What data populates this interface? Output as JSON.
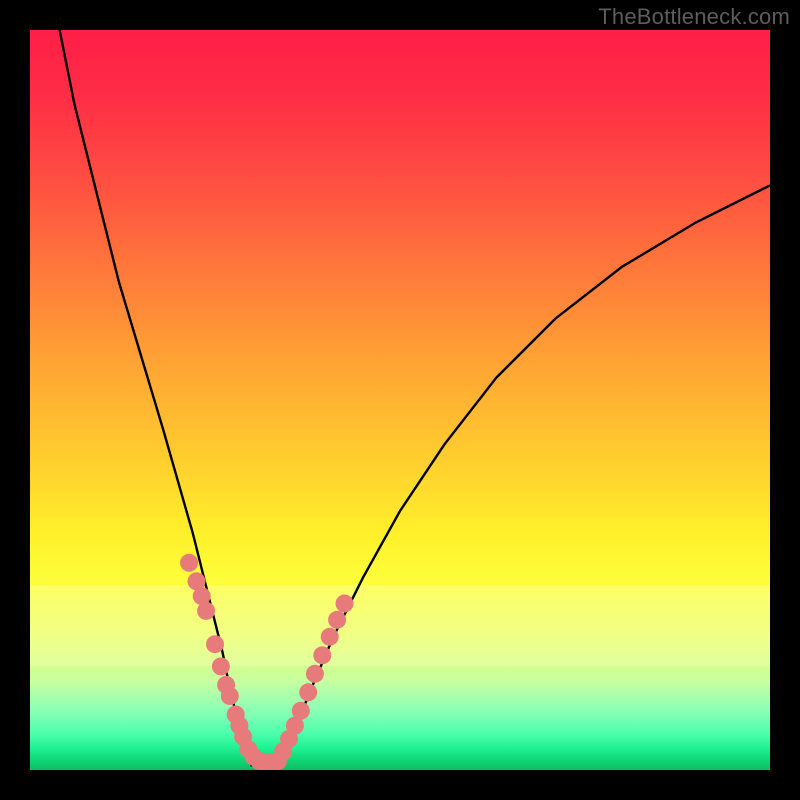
{
  "watermark": "TheBottleneck.com",
  "chart_data": {
    "type": "line",
    "title": "",
    "xlabel": "",
    "ylabel": "",
    "xlim": [
      0,
      100
    ],
    "ylim": [
      0,
      100
    ],
    "grid": false,
    "legend": false,
    "series": [
      {
        "name": "left-curve",
        "x": [
          4,
          6,
          9,
          12,
          15,
          18,
          20,
          22,
          24,
          26,
          27,
          28,
          29,
          29.5,
          30
        ],
        "y": [
          100,
          90,
          78,
          66,
          56,
          46,
          39,
          32,
          24,
          16,
          11,
          7,
          3.5,
          1.5,
          0.5
        ]
      },
      {
        "name": "right-curve",
        "x": [
          33,
          34,
          36,
          38,
          41,
          45,
          50,
          56,
          63,
          71,
          80,
          90,
          100
        ],
        "y": [
          0.5,
          2,
          6,
          11,
          18,
          26,
          35,
          44,
          53,
          61,
          68,
          74,
          79
        ]
      },
      {
        "name": "left-markers",
        "type": "scatter",
        "x": [
          21.5,
          22.5,
          23.2,
          23.8,
          25.0,
          25.8,
          26.5,
          27.0,
          27.8,
          28.3,
          28.8,
          29.5,
          30.2,
          31.0,
          31.8,
          32.5
        ],
        "y": [
          28,
          25.5,
          23.5,
          21.5,
          17,
          14,
          11.5,
          10,
          7.5,
          6,
          4.5,
          2.8,
          1.8,
          1.2,
          1.0,
          1.0
        ]
      },
      {
        "name": "right-markers",
        "type": "scatter",
        "x": [
          33.5,
          34.2,
          35.0,
          35.8,
          36.6,
          37.6,
          38.5,
          39.5,
          40.5,
          41.5,
          42.5
        ],
        "y": [
          1.2,
          2.5,
          4.2,
          6.0,
          8.0,
          10.5,
          13.0,
          15.5,
          18.0,
          20.3,
          22.5
        ]
      }
    ],
    "marker_color": "#e77b7b",
    "curve_color": "#000000",
    "background_gradient": [
      "#ff1f47",
      "#ffce2e",
      "#fff02a",
      "#0bbf62"
    ]
  }
}
